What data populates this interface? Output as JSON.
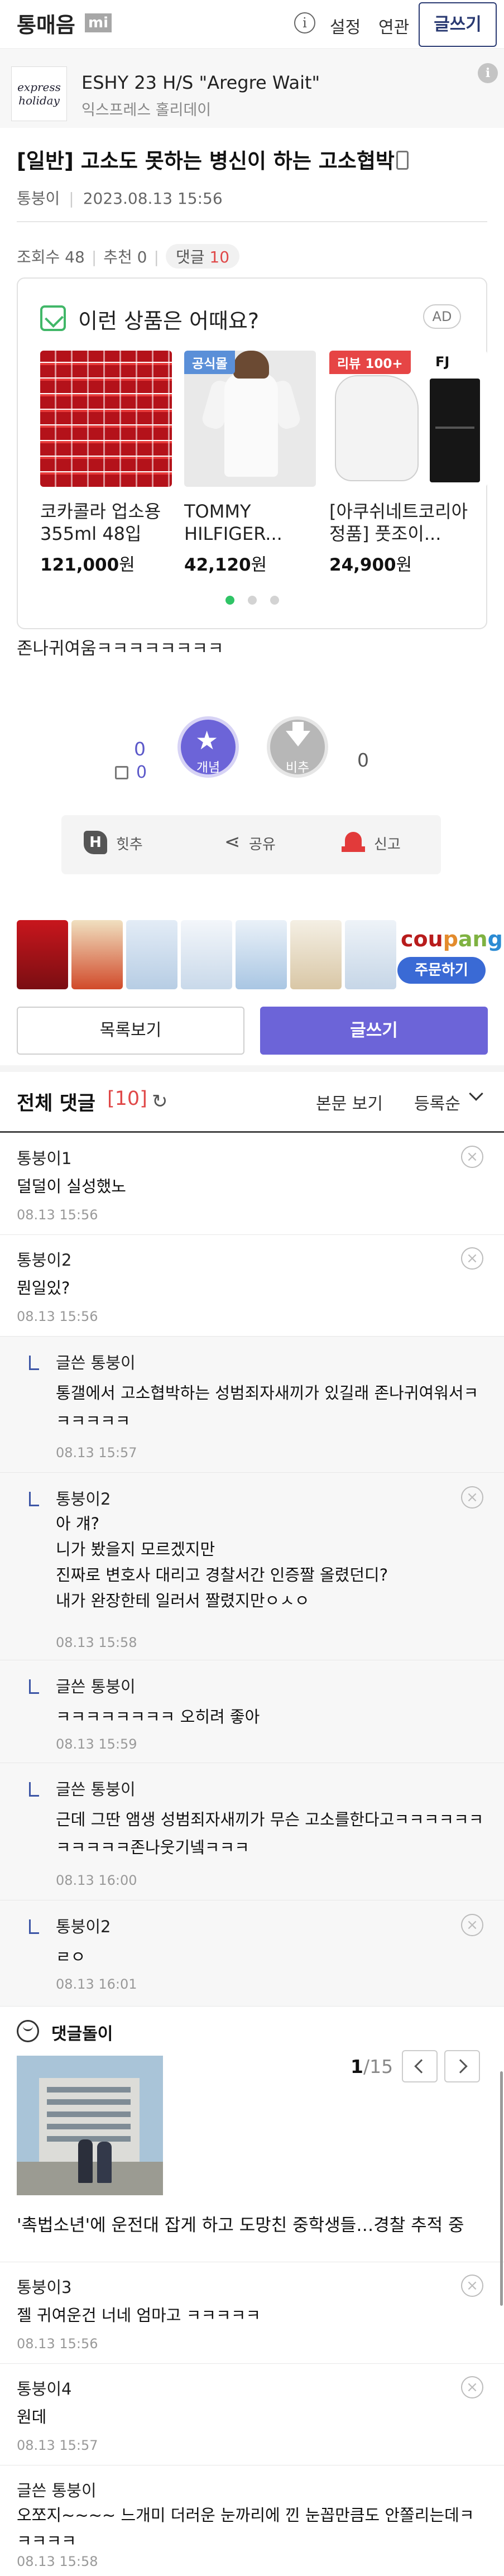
{
  "header": {
    "site_name": "통매음",
    "badge": "mi",
    "nav": [
      "설정",
      "연관"
    ],
    "write_label": "글쓰기",
    "info_glyph": "i"
  },
  "ad_banner": {
    "logo_text": "express holiday",
    "title": "ESHY 23 H/S \"Aregre Wait\"",
    "subtitle": "익스프레스 홀리데이",
    "info_glyph": "i"
  },
  "post": {
    "title": "[일반] 고소도 못하는 병신이 하는 고소협박",
    "author": "통붕이",
    "datetime": "2023.08.13 15:56",
    "views_label": "조회수 48",
    "recommend_label": "추천 0",
    "comment_label": "댓글",
    "comment_count": "10",
    "body": "존나귀여움ㅋㅋㅋㅋㅋㅋㅋㅋ"
  },
  "products": {
    "heading": "이런 상품은 어때요?",
    "ad_tag": "AD",
    "items": [
      {
        "name": "코카콜라 업소용 355ml 48입",
        "price": "121,000",
        "unit": "원",
        "badge": ""
      },
      {
        "name": "TOMMY HILFIGER...",
        "price": "42,120",
        "unit": "원",
        "badge": "공식몰"
      },
      {
        "name": "[아쿠쉬네트코리아정품] 풋조이...",
        "price": "24,900",
        "unit": "원",
        "badge": "리뷰 100+"
      }
    ],
    "brand_mark": "FJ"
  },
  "votes": {
    "up_count": "0",
    "up_sub_count": "0",
    "up_label": "개념",
    "down_label": "비추",
    "down_count": "0"
  },
  "actions": {
    "hits_icon": "H",
    "hits": "힛추",
    "share": "공유",
    "report": "신고"
  },
  "coupang": {
    "brand": [
      "cou",
      "p",
      "an",
      "g"
    ],
    "button": "주문하기"
  },
  "buttons": {
    "list": "목록보기",
    "write": "글쓰기"
  },
  "comments_header": {
    "title": "전체 댓글",
    "count": "[10]",
    "view_post": "본문 보기",
    "sort": "등록순"
  },
  "comments": [
    {
      "author": "통붕이1",
      "text": "덜덜이 실성했노",
      "time": "08.13 15:56",
      "reply": false,
      "deletable": true
    },
    {
      "author": "통붕이2",
      "text": "뭔일있?",
      "time": "08.13 15:56",
      "reply": false,
      "deletable": true
    },
    {
      "author": "글쓴 통붕이",
      "text": "통갤에서 고소협박하는 성범죄자새끼가 있길래 존나귀여워서ㅋㅋㅋㅋㅋㅋ",
      "time": "08.13 15:57",
      "reply": true,
      "deletable": false
    },
    {
      "author": "통붕이2",
      "text": "아 걔?\n니가 봤을지 모르겠지만\n진짜로 변호사 대리고 경찰서간 인증짤 올렸던디?\n내가 완장한테 일러서 짤렸지만ㅇㅅㅇ",
      "time": "08.13 15:58",
      "reply": true,
      "deletable": true
    },
    {
      "author": "글쓴 통붕이",
      "text": "ㅋㅋㅋㅋㅋㅋㅋㅋ 오히려 좋아",
      "time": "08.13 15:59",
      "reply": true,
      "deletable": false
    },
    {
      "author": "글쓴 통붕이",
      "text": "근데 그딴 앰생 성범죄자새끼가 무슨 고소를한다고ㅋㅋㅋㅋㅋㅋㅋㅋㅋㅋㅋ존나웃기넼ㅋㅋㅋ",
      "time": "08.13 16:00",
      "reply": true,
      "deletable": false
    },
    {
      "author": "통붕이2",
      "text": "ㄹㅇ",
      "time": "08.13 16:01",
      "reply": true,
      "deletable": true
    },
    {
      "author": "통붕이3",
      "text": "젤 귀여운건 너네 엄마고 ㅋㅋㅋㅋㅋ",
      "time": "08.13 15:56",
      "reply": false,
      "deletable": true
    },
    {
      "author": "통붕이4",
      "text": "원데",
      "time": "08.13 15:57",
      "reply": false,
      "deletable": true
    },
    {
      "author": "글쓴 통붕이",
      "text": "오쪼지~~~~ 느개미 더러운 눈까리에 낀 눈꼽만큼도 안쫄리는데ㅋㅋㅋㅋㅋ",
      "time": "08.13 15:58",
      "reply": false,
      "deletable": false
    }
  ],
  "comment_bot": {
    "title": "댓글돌이",
    "page_current": "1",
    "page_total": "/15",
    "headline": "'촉법소년'에 운전대 잡게 하고 도망친 중학생들…경찰 추적 중"
  }
}
